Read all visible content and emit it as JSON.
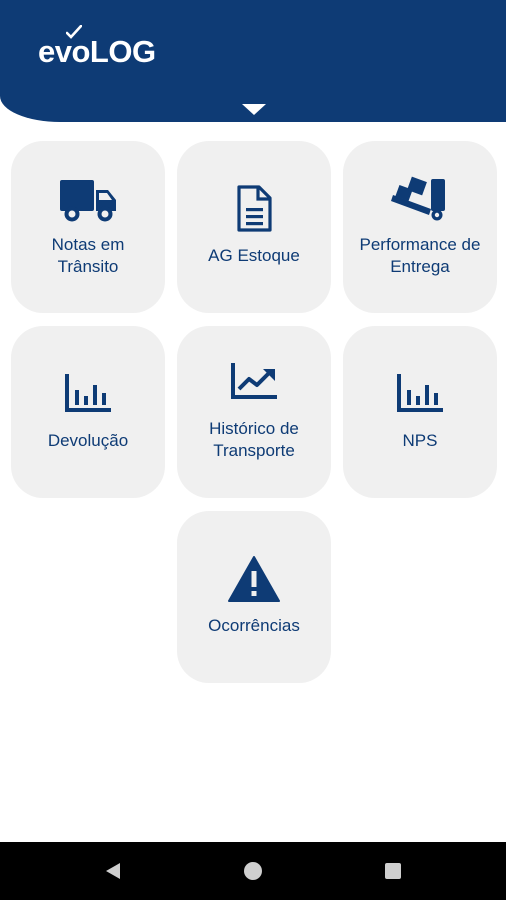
{
  "header": {
    "logo_text": "evoLOG",
    "background_color": "#0e3b75",
    "expand_icon": "caret-down-icon"
  },
  "tiles": [
    {
      "label": "Notas em\nTrânsito",
      "icon": "truck-icon"
    },
    {
      "label": "AG Estoque",
      "icon": "document-icon"
    },
    {
      "label": "Performance de\nEntrega",
      "icon": "dolly-icon"
    },
    {
      "label": "Devolução",
      "icon": "bar-chart-icon"
    },
    {
      "label": "Histórico de\nTransporte",
      "icon": "trending-chart-icon"
    },
    {
      "label": "NPS",
      "icon": "bar-chart-icon"
    },
    {
      "label": "Ocorrências",
      "icon": "warning-icon"
    }
  ],
  "colors": {
    "accent": "#0e3b75",
    "tile_background": "#f0f0f0",
    "navbar": "#000000"
  },
  "navbar": {
    "back": "back-icon",
    "home": "home-icon",
    "recents": "recents-icon"
  }
}
